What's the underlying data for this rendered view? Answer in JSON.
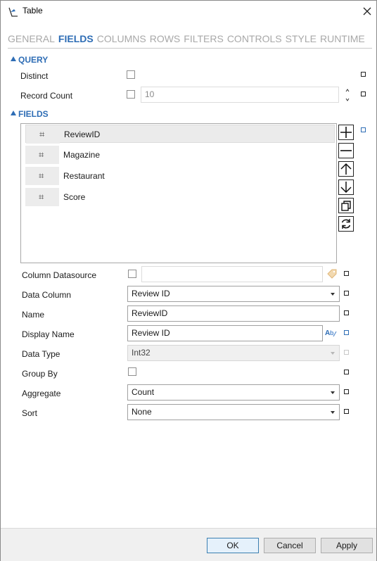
{
  "window": {
    "title": "Table"
  },
  "tabs": [
    {
      "label": "GENERAL",
      "active": false
    },
    {
      "label": "FIELDS",
      "active": true
    },
    {
      "label": "COLUMNS",
      "active": false
    },
    {
      "label": "ROWS",
      "active": false
    },
    {
      "label": "FILTERS",
      "active": false
    },
    {
      "label": "CONTROLS",
      "active": false
    },
    {
      "label": "STYLE",
      "active": false
    },
    {
      "label": "RUNTIME",
      "active": false
    }
  ],
  "query": {
    "title": "QUERY",
    "distinct_label": "Distinct",
    "distinct_checked": false,
    "record_count_label": "Record Count",
    "record_count_checked": false,
    "record_count_value": "10"
  },
  "fields": {
    "title": "FIELDS",
    "hash_glyph": "⌗",
    "items": [
      {
        "name": "ReviewID",
        "selected": true
      },
      {
        "name": "Magazine",
        "selected": false
      },
      {
        "name": "Restaurant",
        "selected": false
      },
      {
        "name": "Score",
        "selected": false
      }
    ],
    "tool_icons": [
      "add-icon",
      "remove-icon",
      "move-up-icon",
      "move-down-icon",
      "duplicate-icon",
      "refresh-icon"
    ]
  },
  "properties": {
    "column_datasource_label": "Column Datasource",
    "column_datasource_checked": false,
    "column_datasource_value": "",
    "data_column_label": "Data Column",
    "data_column_value": "Review ID",
    "name_label": "Name",
    "name_value": "ReviewID",
    "display_name_label": "Display Name",
    "display_name_value": "Review ID",
    "data_type_label": "Data Type",
    "data_type_value": "Int32",
    "group_by_label": "Group By",
    "group_by_checked": false,
    "aggregate_label": "Aggregate",
    "aggregate_value": "Count",
    "sort_label": "Sort",
    "sort_value": "None"
  },
  "buttons": {
    "ok": "OK",
    "cancel": "Cancel",
    "apply": "Apply"
  },
  "colors": {
    "accent": "#2e6db5",
    "tab_inactive": "#a8a8a8",
    "footer_bg": "#f0f0f0"
  }
}
